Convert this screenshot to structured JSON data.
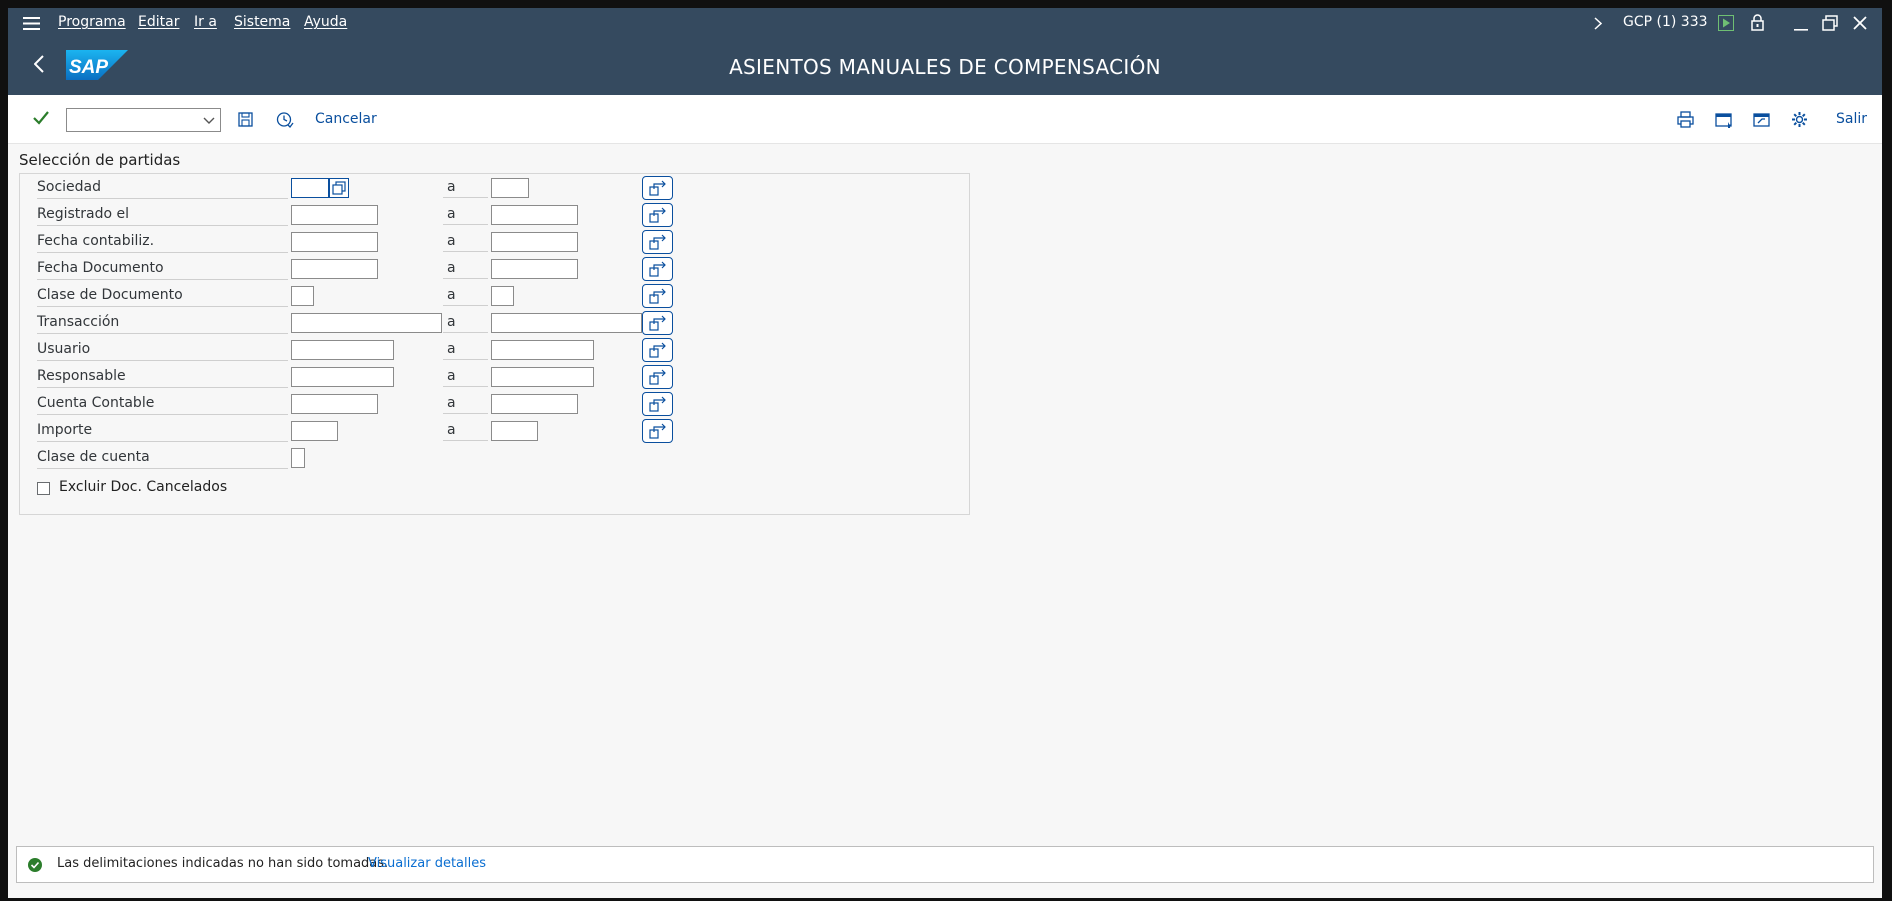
{
  "menubar": {
    "items": [
      "Programa",
      "Editar",
      "Ir a",
      "Sistema",
      "Ayuda"
    ],
    "system_info": "GCP (1) 333"
  },
  "header": {
    "title": "ASIENTOS MANUALES DE COMPENSACIÓN",
    "logo_text": "SAP"
  },
  "toolbar": {
    "command_field_value": "",
    "cancel_label": "Cancelar",
    "exit_label": "Salir"
  },
  "selection": {
    "title": "Selección de partidas",
    "to_label": "a",
    "rows": [
      {
        "label": "Sociedad",
        "from": "",
        "to": ""
      },
      {
        "label": "Registrado el",
        "from": "",
        "to": ""
      },
      {
        "label": "Fecha contabiliz.",
        "from": "",
        "to": ""
      },
      {
        "label": "Fecha Documento",
        "from": "",
        "to": ""
      },
      {
        "label": "Clase de Documento",
        "from": "",
        "to": ""
      },
      {
        "label": "Transacción",
        "from": "",
        "to": ""
      },
      {
        "label": "Usuario",
        "from": "",
        "to": ""
      },
      {
        "label": "Responsable",
        "from": "",
        "to": ""
      },
      {
        "label": "Cuenta Contable",
        "from": "",
        "to": ""
      },
      {
        "label": "Importe",
        "from": "",
        "to": ""
      }
    ],
    "account_class": {
      "label": "Clase de cuenta",
      "value": ""
    },
    "exclude_cancelled": {
      "label": "Excluir Doc. Cancelados",
      "checked": false
    }
  },
  "status": {
    "message": "Las delimitaciones indicadas no han sido tomadas.",
    "details_link": "Visualizar detalles"
  },
  "colors": {
    "shell": "#354a5f",
    "accent": "#0a4f9e",
    "success": "#2b7d2b"
  }
}
